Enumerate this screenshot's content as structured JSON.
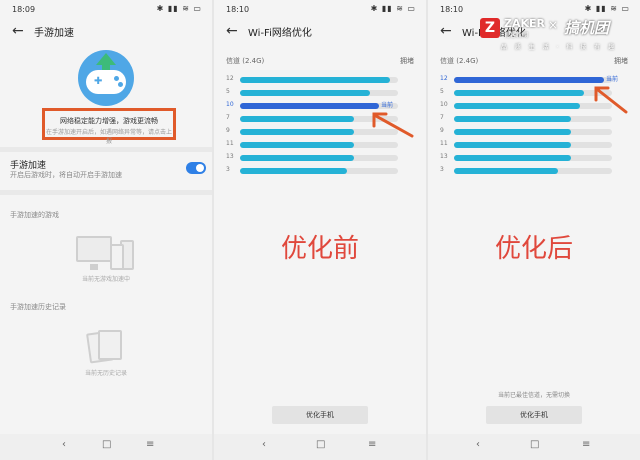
{
  "panel1": {
    "status_time": "18:09",
    "status_icons": "✱ ▮▮ ≋ ▭",
    "title": "手游加速",
    "highlight_line1": "网络稳定能力增强，游戏更流畅",
    "highlight_line2": "在手游加速开启后，如遇网络异常等，请点击上报",
    "setting_title": "手游加速",
    "setting_sub": "开启后游戏时，将自动开启手游加速",
    "toggle_on": true,
    "section1": "手游加速的游戏",
    "empty1": "当前无游戏加速中",
    "section2": "手游加速历史记录",
    "empty2": "当前无历史记录"
  },
  "panel2": {
    "status_time": "18:10",
    "status_icons": "✱ ▮▮ ≋ ▭",
    "title": "Wi-Fi网络优化",
    "head_left": "信道 (2.4G)",
    "head_right": "拥堵",
    "current_label": "当前",
    "channels": [
      {
        "ch": "12",
        "level": 0.95,
        "current": false
      },
      {
        "ch": "5",
        "level": 0.82,
        "current": false
      },
      {
        "ch": "10",
        "level": 0.88,
        "current": true
      },
      {
        "ch": "7",
        "level": 0.72,
        "current": false
      },
      {
        "ch": "9",
        "level": 0.72,
        "current": false
      },
      {
        "ch": "11",
        "level": 0.72,
        "current": false
      },
      {
        "ch": "13",
        "level": 0.72,
        "current": false
      },
      {
        "ch": "3",
        "level": 0.68,
        "current": false
      }
    ],
    "big_label": "优化前",
    "button": "优化手机"
  },
  "panel3": {
    "status_time": "18:10",
    "status_icons": "✱ ▮▮ ≋ ▭",
    "title": "Wi-Fi网络优化",
    "head_left": "信道 (2.4G)",
    "head_right": "拥堵",
    "current_label": "当前",
    "channels": [
      {
        "ch": "12",
        "level": 0.95,
        "current": true
      },
      {
        "ch": "5",
        "level": 0.82,
        "current": false
      },
      {
        "ch": "10",
        "level": 0.8,
        "current": false
      },
      {
        "ch": "7",
        "level": 0.74,
        "current": false
      },
      {
        "ch": "9",
        "level": 0.74,
        "current": false
      },
      {
        "ch": "11",
        "level": 0.74,
        "current": false
      },
      {
        "ch": "13",
        "level": 0.74,
        "current": false
      },
      {
        "ch": "3",
        "level": 0.66,
        "current": false
      }
    ],
    "big_label": "优化后",
    "footnote": "当前已最佳信道，无需切换",
    "button": "优化手机"
  },
  "nav": {
    "back": "‹",
    "home": "□",
    "menu": "≡"
  },
  "watermark": {
    "z": "Z",
    "zaker": "ZAKER",
    "zaker_sub": "扎客新闻",
    "x": "×",
    "brand": "搞机团",
    "tag": "品 质 生 活 · 科 技 有 趣"
  },
  "colors": {
    "accent": "#2f66d6",
    "bar": "#25b2d6",
    "annotation": "#e05a2a",
    "label_red": "#e0483c"
  }
}
